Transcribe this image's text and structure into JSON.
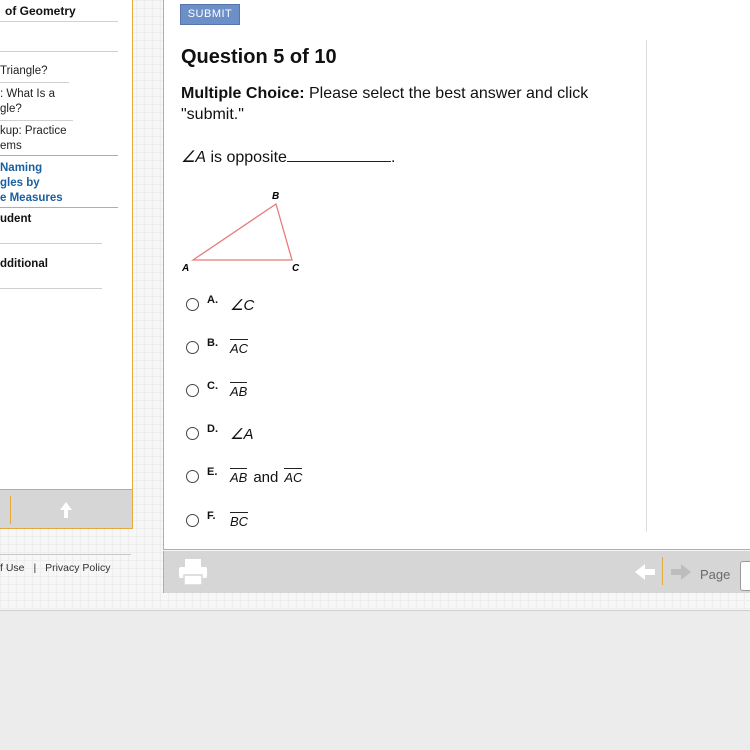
{
  "sidebar": {
    "course_title": "of Geometry",
    "items": [
      {
        "line1": "Triangle?",
        "line2": ""
      },
      {
        "line1": ": What Is a",
        "line2": "gle?"
      },
      {
        "line1": "kup: Practice",
        "line2": "ems"
      },
      {
        "line1": "Naming",
        "line2": "gles by",
        "line3": "e Measures"
      },
      {
        "line1": "udent"
      },
      {
        "line1": "dditional"
      }
    ],
    "legal_terms": "f Use",
    "legal_sep": "|",
    "legal_privacy": "Privacy Policy"
  },
  "main": {
    "submit_label": "SUBMIT",
    "question_title": "Question 5 of 10",
    "instruction_bold": "Multiple Choice:",
    "instruction_text": " Please select the best answer and click \"submit.\"",
    "prompt_angle": "∠A",
    "prompt_text": " is opposite",
    "prompt_end": ".",
    "triangle_labels": {
      "a": "A",
      "b": "B",
      "c": "C"
    },
    "choices": [
      {
        "letter": "A.",
        "type": "angle",
        "value": "∠C"
      },
      {
        "letter": "B.",
        "type": "segment",
        "value": "AC"
      },
      {
        "letter": "C.",
        "type": "segment",
        "value": "AB"
      },
      {
        "letter": "D.",
        "type": "angle",
        "value": "∠A"
      },
      {
        "letter": "E.",
        "type": "segment-pair",
        "value": "AB",
        "joiner": "and",
        "value2": "AC"
      },
      {
        "letter": "F.",
        "type": "segment",
        "value": "BC"
      }
    ]
  },
  "toolbar": {
    "page_label": "Page"
  },
  "colors": {
    "accent_border": "#e3a93a",
    "submit_bg": "#6d8fc7",
    "triangle_stroke": "#e87c7c",
    "active_link": "#1a5fa0"
  }
}
